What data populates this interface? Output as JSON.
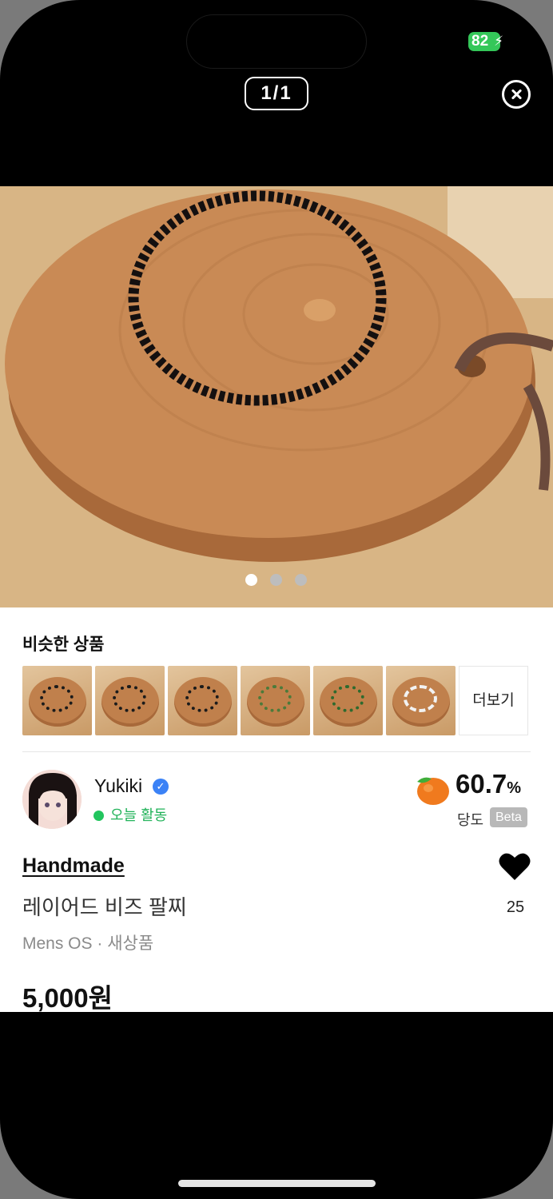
{
  "status_bar": {
    "battery": "82"
  },
  "viewer": {
    "counter": "1/1"
  },
  "photo": {
    "carousel_dots": 3,
    "active_dot": 0
  },
  "similar": {
    "title": "비슷한 상품",
    "more_label": "더보기",
    "thumb_ring_colors": [
      "#1b1b1b",
      "#1b1b1b",
      "#1b1b1b",
      "#4c7a3a",
      "#2e6a2e",
      "#f2f2f2"
    ]
  },
  "seller": {
    "name": "Yukiki",
    "status": "오늘 활동",
    "temperature_value": "60.7",
    "temperature_unit": "%",
    "temperature_label": "당도",
    "beta_badge": "Beta"
  },
  "product": {
    "category": "Handmade",
    "title": "레이어드 비즈 팔찌",
    "meta": "Mens OS · 새상품",
    "price": "5,000원",
    "likes": "25"
  },
  "colors": {
    "accent_green": "#22c55e",
    "verified_blue": "#3b82f6",
    "battery_green": "#34c759"
  }
}
